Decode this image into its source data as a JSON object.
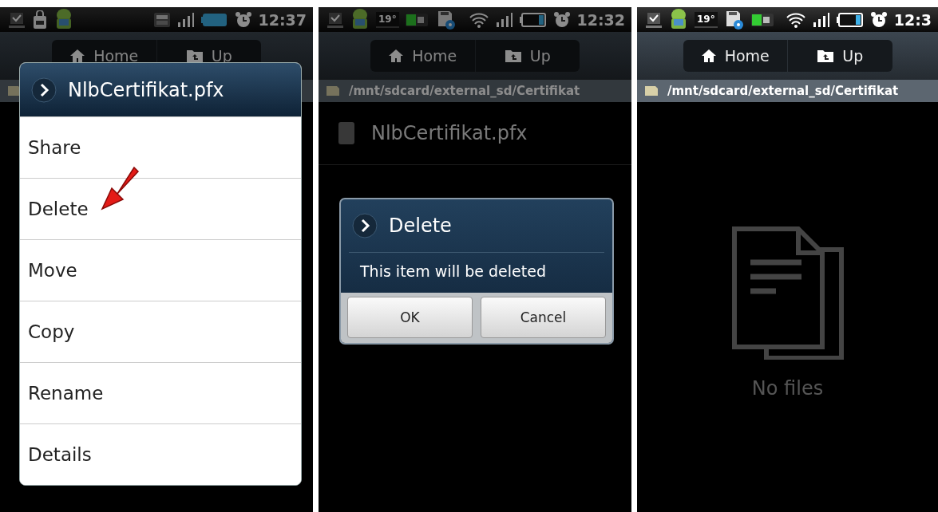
{
  "screens": [
    {
      "kind": "context_menu",
      "dimmed": true,
      "status_bar": {
        "time": "12:37"
      },
      "toolbar": [
        "Home",
        "Up"
      ],
      "menu": {
        "title": "NlbCertifikat.pfx",
        "items": [
          "Share",
          "Delete",
          "Move",
          "Copy",
          "Rename",
          "Details"
        ]
      }
    },
    {
      "kind": "delete_dialog",
      "dimmed": true,
      "status_bar": {
        "temperature": "19°",
        "time": "12:32"
      },
      "toolbar": [
        "Home",
        "Up"
      ],
      "path": "/mnt/sdcard/external_sd/Certifikat",
      "files": [
        "NlbCertifikat.pfx"
      ],
      "dialog": {
        "title": "Delete",
        "message": "This item will be deleted",
        "buttons": [
          "OK",
          "Cancel"
        ]
      }
    },
    {
      "kind": "empty",
      "dimmed": false,
      "status_bar": {
        "temperature": "19°",
        "time": "12:3"
      },
      "toolbar": [
        "Home",
        "Up"
      ],
      "path": "/mnt/sdcard/external_sd/Certifikat",
      "empty_text": "No files"
    }
  ]
}
